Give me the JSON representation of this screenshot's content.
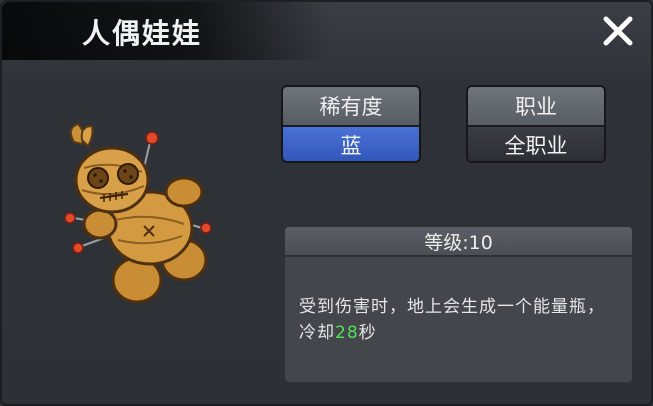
{
  "title": "人偶娃娃",
  "attributes": {
    "rarity": {
      "label": "稀有度",
      "value": "蓝"
    },
    "job": {
      "label": "职业",
      "value": "全职业"
    }
  },
  "description": {
    "header": "等级:10",
    "text_part1": "受到伤害时，地上会生成一个能量瓶，冷却",
    "highlight": "28",
    "text_part2": "秒"
  },
  "colors": {
    "rarity_blue": "#3a63c7",
    "highlight_green": "#55e05a"
  },
  "icons": {
    "close": "close-icon",
    "item": "voodoo-doll-icon"
  }
}
